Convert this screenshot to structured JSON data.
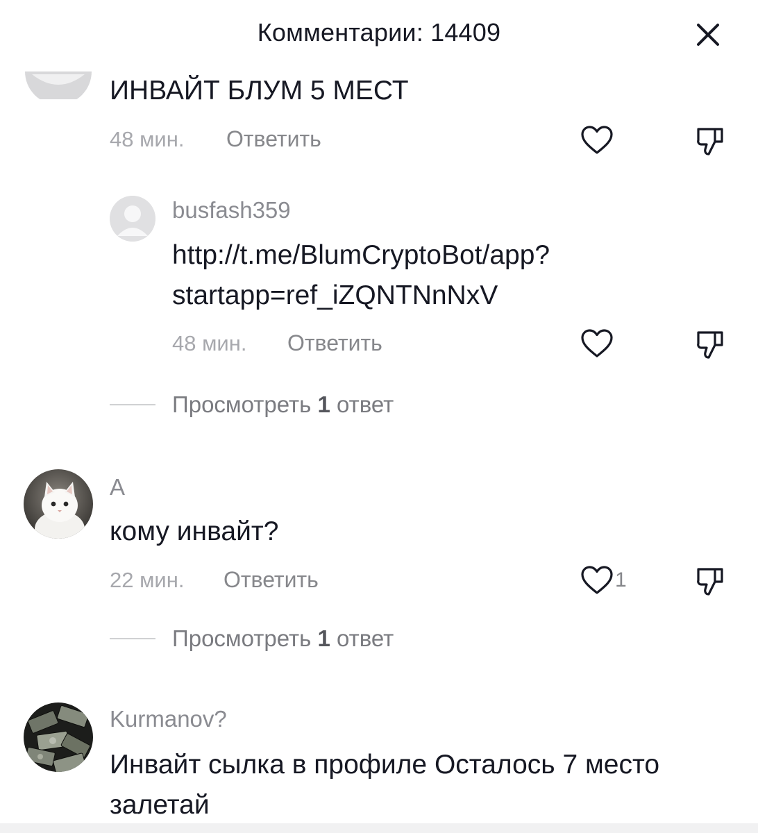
{
  "header": {
    "title": "Комментарии: 14409"
  },
  "comments": [
    {
      "text": "ИНВАЙТ БЛУМ 5 МЕСТ",
      "time": "48 мин.",
      "reply_label": "Ответить"
    },
    {
      "username": "busfash359",
      "text_line1": "http://t.me/BlumCryptoBot/app?",
      "text_line2": "startapp=ref_iZQNTNnNxV",
      "time": "48 мин.",
      "reply_label": "Ответить",
      "view_replies_prefix": "Просмотреть ",
      "view_replies_count": "1",
      "view_replies_suffix": " ответ"
    },
    {
      "username": "A",
      "text": "кому инвайт?",
      "time": "22 мин.",
      "reply_label": "Ответить",
      "likes": "1",
      "view_replies_prefix": "Просмотреть ",
      "view_replies_count": "1",
      "view_replies_suffix": " ответ"
    },
    {
      "username": "Kurmanov?",
      "text_line1": "Инвайт сылка в профиле Осталось 7 место",
      "text_line2": "залетай"
    }
  ]
}
